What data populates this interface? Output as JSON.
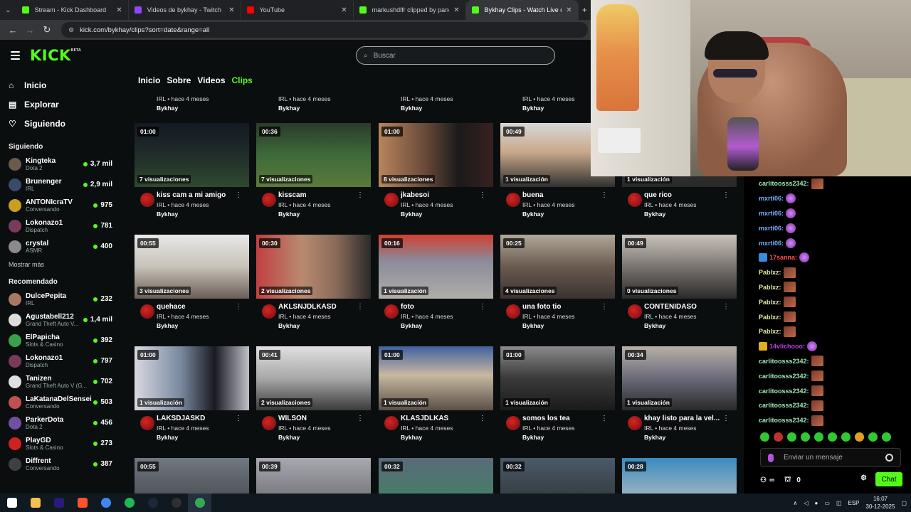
{
  "browser": {
    "tabs": [
      {
        "title": "Stream - Kick Dashboard",
        "color": "#53fc18"
      },
      {
        "title": "Videos de bykhay - Twitch",
        "color": "#9146ff"
      },
      {
        "title": "YouTube",
        "color": "#ff0000"
      },
      {
        "title": "markushdlfr clipped by pancho",
        "color": "#53fc18"
      },
      {
        "title": "Bykhay Clips - Watch Live on K",
        "color": "#53fc18"
      }
    ],
    "url": "kick.com/bykhay/clips?sort=date&range=all"
  },
  "kick": {
    "logo": "KICK",
    "logo_badge": "BETA",
    "search_placeholder": "Buscar",
    "nav": [
      {
        "label": "Inicio",
        "icon": "home-icon"
      },
      {
        "label": "Explorar",
        "icon": "explore-icon"
      },
      {
        "label": "Siguiendo",
        "icon": "heart-icon"
      }
    ],
    "following_heading": "Siguiendo",
    "following": [
      {
        "name": "Kingteka",
        "category": "Dota 2",
        "viewers": "3,7 mil",
        "color": "#6a5a4a"
      },
      {
        "name": "Brunenger",
        "category": "IRL",
        "viewers": "2,9 mil",
        "color": "#3a4a6a"
      },
      {
        "name": "ANTONIcraTV",
        "category": "Conversando",
        "viewers": "975",
        "color": "#c8a020"
      },
      {
        "name": "Lokonazo1",
        "category": "Dispatch",
        "viewers": "781",
        "color": "#7a3a5a"
      },
      {
        "name": "crystal",
        "category": "ASMR",
        "viewers": "400",
        "color": "#8a8a8a"
      }
    ],
    "show_more": "Mostrar más",
    "recommended_heading": "Recomendado",
    "recommended": [
      {
        "name": "DulcePepita",
        "category": "IRL",
        "viewers": "232",
        "color": "#aa7766"
      },
      {
        "name": "Agustabell212",
        "category": "Grand Theft Auto V...",
        "viewers": "1,4 mil",
        "color": "#dddddd"
      },
      {
        "name": "ElPapicha",
        "category": "Slots & Casino",
        "viewers": "392",
        "color": "#3aa04a"
      },
      {
        "name": "Lokonazo1",
        "category": "Dispatch",
        "viewers": "797",
        "color": "#7a3a5a"
      },
      {
        "name": "Tanizen",
        "category": "Grand Theft Auto V (G...",
        "viewers": "702",
        "color": "#e0e0e0"
      },
      {
        "name": "LaKatanaDelSensei",
        "category": "Conversando",
        "viewers": "503",
        "color": "#c05050"
      },
      {
        "name": "ParkerDota",
        "category": "Dota 2",
        "viewers": "456",
        "color": "#7050a0"
      },
      {
        "name": "PlayGD",
        "category": "Slots & Casino",
        "viewers": "273",
        "color": "#d02020"
      },
      {
        "name": "Diffrent",
        "category": "Conversando",
        "viewers": "387",
        "color": "#404040"
      }
    ],
    "tabs": [
      "Inicio",
      "Sobre",
      "Videos",
      "Clips"
    ],
    "active_tab": "Clips",
    "partial_row": [
      {
        "sub": "IRL • hace 4 meses",
        "channel": "Bykhay"
      },
      {
        "sub": "IRL • hace 4 meses",
        "channel": "Bykhay"
      },
      {
        "sub": "IRL • hace 4 meses",
        "channel": "Bykhay"
      },
      {
        "sub": "IRL • hace 4 meses",
        "channel": "Bykhay"
      }
    ],
    "clips": [
      [
        {
          "duration": "01:00",
          "views": "7 visualizaciones",
          "title": "kiss cam a mi amigo",
          "sub": "IRL • hace 4 meses",
          "channel": "Bykhay",
          "bg": "linear-gradient(180deg,#141a22 0%,#1f2a2a 45%,#2f4a2e 100%)"
        },
        {
          "duration": "00:36",
          "views": "7 visualizaciones",
          "title": "kisscam",
          "sub": "IRL • hace 4 meses",
          "channel": "Bykhay",
          "bg": "linear-gradient(180deg,#2a3a2a 0%,#3e6a3a 50%,#5a7a3a 100%)"
        },
        {
          "duration": "01:00",
          "views": "8 visualizaciones",
          "title": "jkabesoi",
          "sub": "IRL • hace 4 meses",
          "channel": "Bykhay",
          "bg": "linear-gradient(90deg,#b8855c 0%,#6a4a3a 40%,#1a1a1a 70%,#3a2020 100%)"
        },
        {
          "duration": "00:49",
          "views": "1 visualización",
          "title": "buena",
          "sub": "IRL • hace 4 meses",
          "channel": "Bykhay",
          "bg": "linear-gradient(180deg,#d8d8d8 0%,#c9a98a 45%,#303030 100%)"
        },
        {
          "duration": "",
          "views": "1 visualización",
          "title": "que rico",
          "sub": "IRL • hace 4 meses",
          "channel": "Bykhay",
          "bg": "linear-gradient(180deg,#3a3a3a 0%,#2a2a2a 100%)"
        }
      ],
      [
        {
          "duration": "00:55",
          "views": "3 visualizaciones",
          "title": "quehace",
          "sub": "IRL • hace 4 meses",
          "channel": "Bykhay",
          "bg": "linear-gradient(180deg,#e8e8e8 0%,#c8c2b8 50%,#6a5e58 100%)"
        },
        {
          "duration": "00:30",
          "views": "2 visualizaciones",
          "title": "AKLSNJDLKASD",
          "sub": "IRL • hace 4 meses",
          "channel": "Bykhay",
          "bg": "linear-gradient(90deg,#c04040 0%,#b88a70 40%,#8a6a5a 70%,#2a2a2a 100%)"
        },
        {
          "duration": "00:16",
          "views": "1 visualización",
          "title": "foto",
          "sub": "IRL • hace 4 meses",
          "channel": "Bykhay",
          "bg": "linear-gradient(180deg,#d04030 0%,#8a8a9a 40%,#b0aea8 100%)"
        },
        {
          "duration": "00:25",
          "views": "4 visualizaciones",
          "title": "una foto tio",
          "sub": "IRL • hace 4 meses",
          "channel": "Bykhay",
          "bg": "linear-gradient(180deg,#b0a898 0%,#6a5a50 50%,#3a3230 100%)"
        },
        {
          "duration": "00:49",
          "views": "0 visualizaciones",
          "title": "CONTENIDASO",
          "sub": "IRL • hace 4 meses",
          "channel": "Bykhay",
          "bg": "linear-gradient(180deg,#c8c4bc 0%,#7a7470 50%,#2a2a2a 100%)"
        }
      ],
      [
        {
          "duration": "01:00",
          "views": "1 visualización",
          "title": "LAKSDJASKD",
          "sub": "IRL • hace 4 meses",
          "channel": "Bykhay",
          "bg": "linear-gradient(90deg,#d8d8e0 0%,#7a8aa0 40%,#1a1a22 70%,#c0c0c8 100%)"
        },
        {
          "duration": "00:41",
          "views": "2 visualizaciones",
          "title": "WILSON",
          "sub": "IRL • hace 4 meses",
          "channel": "Bykhay",
          "bg": "linear-gradient(180deg,#e0e0e0 0%,#a8a8a8 50%,#3a3a3a 100%)"
        },
        {
          "duration": "01:00",
          "views": "1 visualización",
          "title": "KLASJDLKAS",
          "sub": "IRL • hace 4 meses",
          "channel": "Bykhay",
          "bg": "linear-gradient(180deg,#4060a0 0%,#c8b8a0 45%,#5a5048 100%)"
        },
        {
          "duration": "01:00",
          "views": "1 visualización",
          "title": "somos los tea",
          "sub": "IRL • hace 4 meses",
          "channel": "Bykhay",
          "bg": "linear-gradient(180deg,#8a8a8a 0%,#3a3a3a 50%,#1a1a1a 100%)"
        },
        {
          "duration": "00:34",
          "views": "1 visualización",
          "title": "khay listo para la vel...",
          "sub": "IRL • hace 4 meses",
          "channel": "Bykhay",
          "bg": "linear-gradient(180deg,#b8b0a8 0%,#6a6a7a 50%,#2a2a2a 100%)"
        }
      ],
      [
        {
          "duration": "00:55",
          "bg": "linear-gradient(180deg,#707880 0%,#3a3a40 100%)"
        },
        {
          "duration": "00:39",
          "bg": "linear-gradient(180deg,#a8a8b0 0%,#5a5a60 100%)"
        },
        {
          "duration": "00:32",
          "bg": "linear-gradient(180deg,#5a6a7a 0%,#3a8a5a 100%)"
        },
        {
          "duration": "00:32",
          "bg": "linear-gradient(180deg,#4a5a6a 0%,#2a2a2a 100%)"
        },
        {
          "duration": "00:28",
          "bg": "linear-gradient(180deg,#3a8ac0 0%,#e0d0c0 100%)"
        }
      ]
    ]
  },
  "chat": {
    "messages": [
      {
        "user": "carlitoosss2342:",
        "color": "#9ee8b8",
        "badge": "",
        "emote": "img"
      },
      {
        "user": "mxrti06:",
        "color": "#7ab0ff",
        "badge": "",
        "emote": "purple"
      },
      {
        "user": "mxrti06:",
        "color": "#7ab0ff",
        "badge": "",
        "emote": "purple"
      },
      {
        "user": "mxrti06:",
        "color": "#7ab0ff",
        "badge": "",
        "emote": "purple"
      },
      {
        "user": "mxrti06:",
        "color": "#7ab0ff",
        "badge": "",
        "emote": "purple"
      },
      {
        "user": "17sanna:",
        "color": "#ff4a4a",
        "badge": "#3a8adf",
        "emote": "purple"
      },
      {
        "user": "Pablxz:",
        "color": "#dfe8a0",
        "badge": "",
        "emote": "img"
      },
      {
        "user": "Pablxz:",
        "color": "#dfe8a0",
        "badge": "",
        "emote": "img"
      },
      {
        "user": "Pablxz:",
        "color": "#dfe8a0",
        "badge": "",
        "emote": "img"
      },
      {
        "user": "Pablxz:",
        "color": "#dfe8a0",
        "badge": "",
        "emote": "img"
      },
      {
        "user": "Pablxz:",
        "color": "#dfe8a0",
        "badge": "",
        "emote": "img"
      },
      {
        "user": "14vlichooo:",
        "color": "#c03adf",
        "badge": "#e0b020",
        "emote": "purple"
      },
      {
        "user": "carlitoosss2342:",
        "color": "#9ee8b8",
        "badge": "",
        "emote": "img"
      },
      {
        "user": "carlitoosss2342:",
        "color": "#9ee8b8",
        "badge": "",
        "emote": "img"
      },
      {
        "user": "carlitoosss2342:",
        "color": "#9ee8b8",
        "badge": "",
        "emote": "img"
      },
      {
        "user": "carlitoosss2342:",
        "color": "#9ee8b8",
        "badge": "",
        "emote": "img"
      },
      {
        "user": "carlitoosss2342:",
        "color": "#9ee8b8",
        "badge": "",
        "emote": "img"
      }
    ],
    "input_placeholder": "Enviar un mensaje",
    "infinity": "∞",
    "points": "0",
    "chat_button": "Chat"
  },
  "taskbar": {
    "apps": [
      "windows-start-icon",
      "file-explorer-icon",
      "premiere-icon",
      "brave-icon",
      "chrome-icon",
      "spotify-icon",
      "steam-icon",
      "obs-icon",
      "chrome-profile-icon"
    ],
    "lang": "ESP",
    "time": "16:07",
    "date": "30-12-2025"
  },
  "colors": {
    "accent": "#53fc18",
    "page_bg": "#0b0e0f"
  }
}
